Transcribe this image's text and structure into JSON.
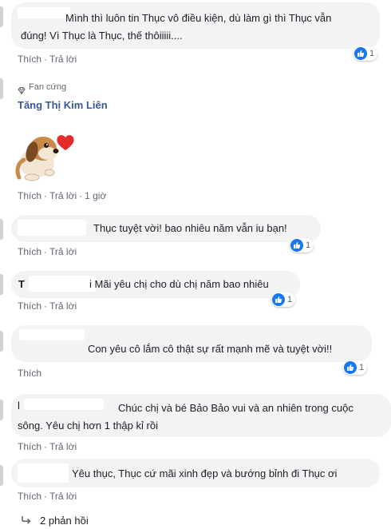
{
  "actions": {
    "like": "Thích",
    "reply": "Trả lời",
    "separator": "·"
  },
  "comments": [
    {
      "line1": "Mình thì luôn tin Thục vô điều kiện, dù làm gì thì Thục vẫn",
      "line2": "đúng! Vì Thục là Thục, thế thôiiiii....",
      "likes": "1"
    },
    {
      "badge": "Fan cứng",
      "name": "Tăng Thị Kim Liên",
      "time": "1 giờ"
    },
    {
      "text": "Thục tuyệt vời! bao nhiêu năm vẫn iu bạn!",
      "likes": "1"
    },
    {
      "initial": "T",
      "text": "i Mãi yêu chị cho dù chị năm bao nhiêu",
      "likes": "1"
    },
    {
      "text": "Con yêu cô lắm cô thật sự rất mạnh mẽ và tuyệt vời!!",
      "likes": "1"
    },
    {
      "initial": "l",
      "line1": "Chúc chị và bé Bảo Bảo vui và an nhiên trong cuộc",
      "line2": "sông. Yêu chị hơn 1 thập kỉ rồi"
    },
    {
      "text": "Yêu thục, Thục cứ mãi xinh đẹp và bướng bỉnh đi Thục ơi"
    }
  ],
  "replies": {
    "label": "2 phản hồi"
  },
  "icons": {
    "like": "thumbs-up-icon",
    "reply_arrow": "reply-arrow-icon",
    "fan_badge": "diamond-icon",
    "sticker": "dog-heart-sticker"
  },
  "colors": {
    "like_blue": "#1877f2",
    "name_blue": "#385898",
    "bubble": "#f2f3f5",
    "meta_gray": "#606770"
  }
}
